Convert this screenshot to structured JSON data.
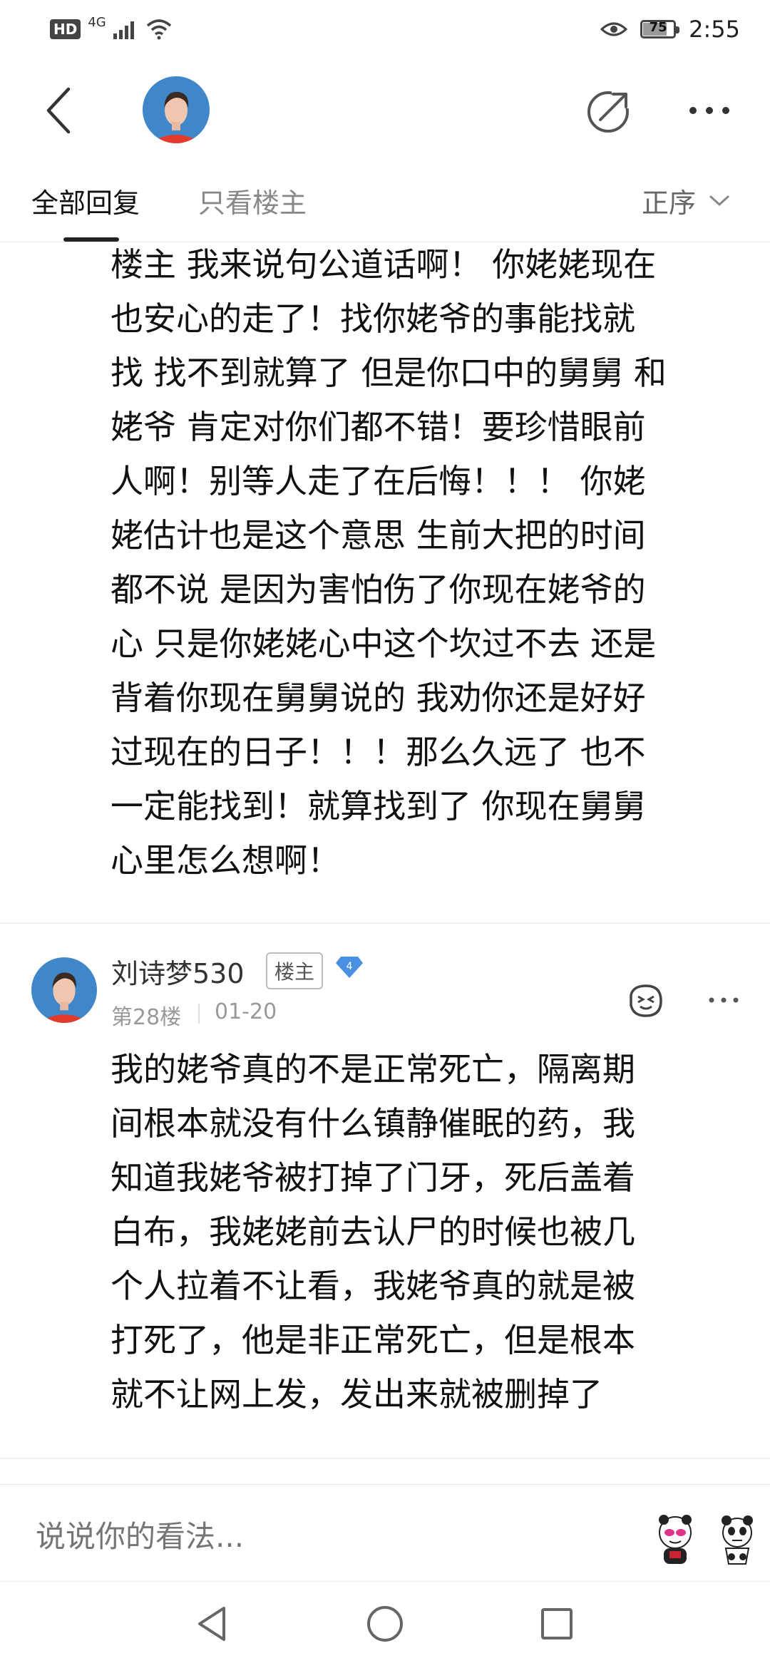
{
  "status_bar": {
    "hd": "HD",
    "network": "4G",
    "battery": "75",
    "battery_level": 0.75,
    "time": "2:55"
  },
  "header": {
    "icons": [
      "back-arrow-icon",
      "share-icon",
      "more-icon"
    ]
  },
  "tabs": {
    "all_replies": "全部回复",
    "owner_only": "只看楼主",
    "sort": "正序"
  },
  "replies": [
    {
      "text": "楼主 我来说句公道话啊！ 你姥姥现在\n也安心的走了！找你姥爷的事能找就\n找 找不到就算了 但是你口中的舅舅 和\n姥爷 肯定对你们都不错！要珍惜眼前\n人啊！别等人走了在后悔！！！ 你姥\n姥估计也是这个意思 生前大把的时间\n都不说 是因为害怕伤了你现在姥爷的\n心 只是你姥姥心中这个坎过不去 还是\n背着你现在舅舅说的 我劝你还是好好\n过现在的日子！！！那么久远了 也不\n一定能找到！就算找到了 你现在舅舅\n心里怎么想啊！"
    },
    {
      "username": "刘诗梦530",
      "owner_badge": "楼主",
      "level": "4",
      "floor": "第28楼",
      "date": "01-20",
      "text": "我的姥爷真的不是正常死亡，隔离期\n间根本就没有什么镇静催眠的药，我\n知道我姥爷被打掉了门牙，死后盖着\n白布，我姥姥前去认尸的时候也被几\n个人拉着不让看，我姥爷真的就是被\n打死了，他是非正常死亡，但是根本\n就不让网上发，发出来就被删掉了"
    }
  ],
  "bottom": {
    "placeholder": "说说你的看法..."
  },
  "colors": {
    "accent_blue": "#4a90e2",
    "avatar_bg": "#3f87c9",
    "shirt_red": "#e33a2b"
  }
}
